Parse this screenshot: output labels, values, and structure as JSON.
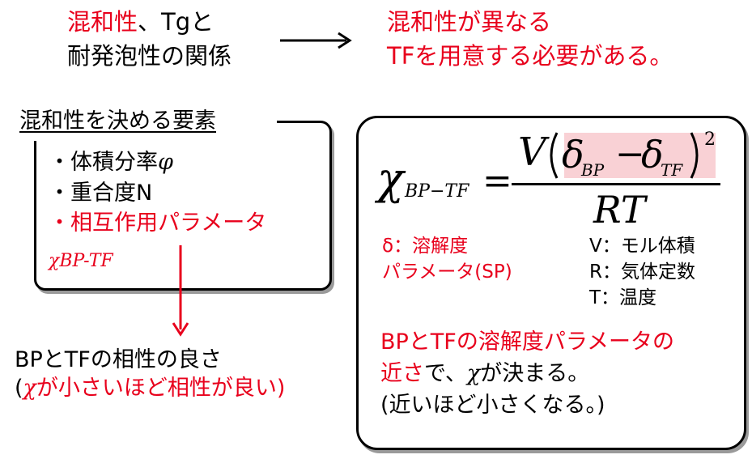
{
  "top_left": {
    "line1_red": "混和性",
    "line1_black": "、Tgと",
    "line2": "耐発泡性の関係"
  },
  "top_right": {
    "line1": "混和性が異なる",
    "line2": "TFを用意する必要がある。"
  },
  "factors": {
    "heading": "混和性を決める要素",
    "items": [
      "・体積分率",
      "・重合度N",
      "・相互作用パラメータ"
    ],
    "phi_symbol": "φ",
    "chi_label": "χBP-TF"
  },
  "result": {
    "line1": "BPとTFの相性の良さ",
    "line2_open": "(",
    "line2_chi": "χ",
    "line2_rest": "が小さいほど相性が良い)"
  },
  "formula": {
    "lhs_chi": "χ",
    "lhs_sub": "BP−TF",
    "equals": "=",
    "num_V": "V",
    "num_delta1": "δ",
    "num_sub1": "BP",
    "num_minus": "−",
    "num_delta2": "δ",
    "num_sub2": "TF",
    "num_sup": "2",
    "denominator": "RT"
  },
  "legend": {
    "delta_line1": "δ：溶解度",
    "delta_line2": "パラメータ(SP)",
    "v": "V：モル体積",
    "r": "R：気体定数",
    "t": "T：温度"
  },
  "conclusion": {
    "line1": "BPとTFの溶解度パラメータの",
    "line2_red": "近さ",
    "line2_mid": "で、",
    "line2_chi": "χ",
    "line2_end": "が決まる。",
    "line3": "(近いほど小さくなる。)"
  },
  "colors": {
    "accent_red": "#e8001c",
    "highlight": "#f9d1d5"
  }
}
